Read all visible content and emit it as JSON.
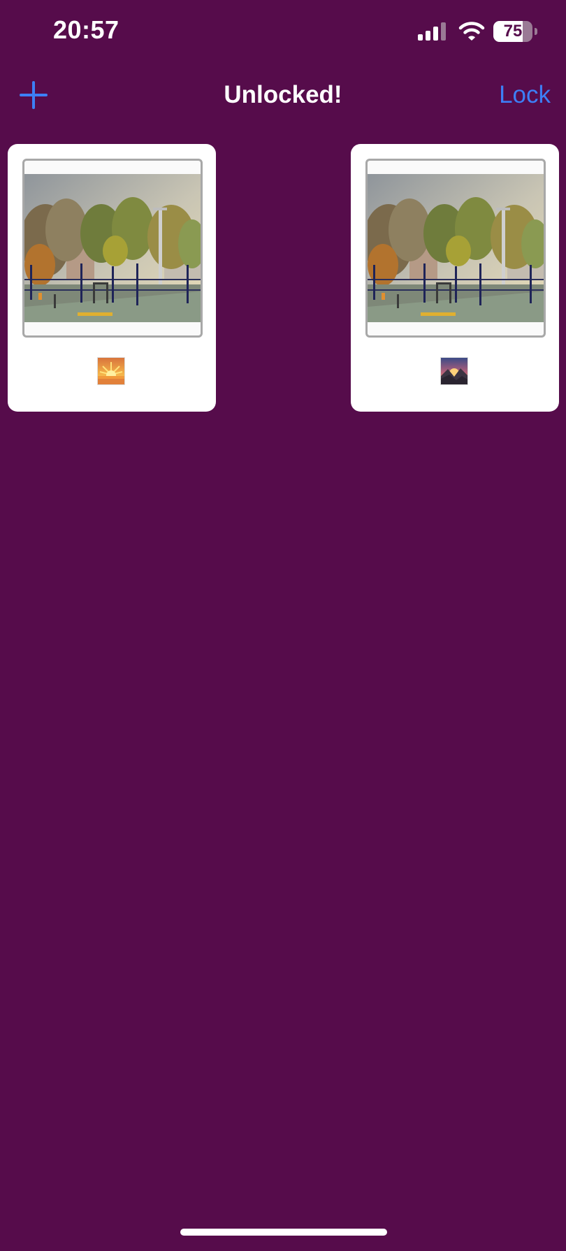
{
  "status_bar": {
    "time": "20:57",
    "battery_level": "75",
    "battery_fraction": 0.75,
    "icons": [
      "cellular-signal-icon",
      "wifi-icon",
      "battery-icon"
    ]
  },
  "nav": {
    "title": "Unlocked!",
    "add_icon": "plus-icon",
    "lock_label": "Lock"
  },
  "cards": [
    {
      "photo": "playground-photo",
      "emoji_icon": "sunrise-icon"
    },
    {
      "photo": "playground-photo",
      "emoji_icon": "sunrise-over-mountains-icon"
    }
  ],
  "colors": {
    "background": "#560c4b",
    "accent": "#3d7ff6",
    "card": "#ffffff"
  }
}
